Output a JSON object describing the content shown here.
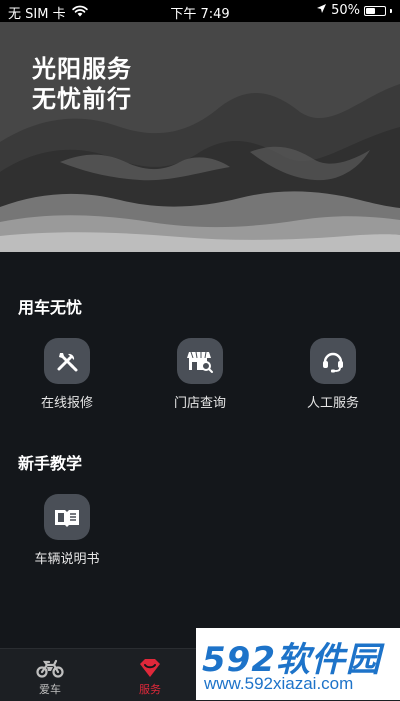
{
  "status_bar": {
    "carrier": "无 SIM 卡",
    "time": "下午 7:49",
    "battery": "50%",
    "battery_level": 0.5
  },
  "hero": {
    "line1": "光阳服务",
    "line2": "无忧前行"
  },
  "sections": [
    {
      "title": "用车无忧",
      "items": [
        {
          "label": "在线报修",
          "icon": "wrench-screwdriver-icon"
        },
        {
          "label": "门店查询",
          "icon": "store-search-icon"
        },
        {
          "label": "人工服务",
          "icon": "headset-icon"
        }
      ]
    },
    {
      "title": "新手教学",
      "items": [
        {
          "label": "车辆说明书",
          "icon": "book-icon"
        }
      ]
    }
  ],
  "tab_bar": {
    "tabs": [
      {
        "label": "爱车",
        "icon": "motorcycle-icon",
        "active": false
      },
      {
        "label": "服务",
        "icon": "heart-diamond-icon",
        "active": true
      }
    ],
    "active_color": "#e0283a",
    "inactive_color": "#bfbfbf"
  },
  "watermark": {
    "brand": "592软件园",
    "url": "www.592xiazai.com"
  }
}
